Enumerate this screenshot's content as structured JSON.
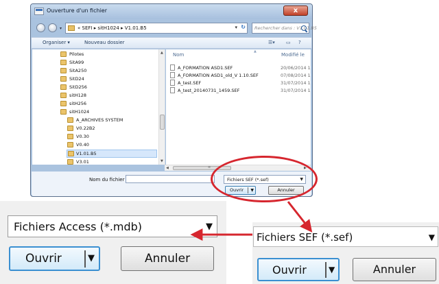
{
  "dialog": {
    "title": "Ouverture d'un fichier",
    "close_label": "x",
    "address": "« SEFI ▸ sitH1024 ▸ V1.01.B5",
    "search_placeholder": "Rechercher dans : V1.01.B5",
    "toolbar": {
      "organize": "Organiser ▾",
      "new_folder": "Nouveau dossier"
    },
    "tree_items": [
      {
        "label": "Pilotes"
      },
      {
        "label": "SitA99"
      },
      {
        "label": "SitA250"
      },
      {
        "label": "SitD24"
      },
      {
        "label": "SitD256"
      },
      {
        "label": "sitH128"
      },
      {
        "label": "sitH256"
      },
      {
        "label": "sitH1024"
      },
      {
        "label": "A_ARCHIVES SYSTEM"
      },
      {
        "label": "V0.22B2"
      },
      {
        "label": "V0.30"
      },
      {
        "label": "V0.40"
      },
      {
        "label": "V1.01.B5"
      },
      {
        "label": "V3.01"
      }
    ],
    "columns": {
      "name": "Nom",
      "modified": "Modifié le"
    },
    "files": [
      {
        "name": "A_FORMATION ASD1.SEF",
        "date": "20/06/2014 1"
      },
      {
        "name": "A_FORMATION ASD1_old_V 1.10.SEF",
        "date": "07/08/2014 1"
      },
      {
        "name": "A_test.SEF",
        "date": "31/07/2014 1"
      },
      {
        "name": "A_test_20140731_1459.SEF",
        "date": "31/07/2014 1"
      }
    ],
    "filename_label": "Nom du fichier :",
    "filename_value": "",
    "filter_value": "Fichiers SEF (*.sef)",
    "open_label": "Ouvrir",
    "cancel_label": "Annuler"
  },
  "zoom_left": {
    "filter_value": "Fichiers Access (*.mdb)",
    "open_label": "Ouvrir",
    "cancel_label": "Annuler"
  },
  "zoom_right": {
    "filter_value": "Fichiers SEF (*.sef)",
    "open_label": "Ouvrir",
    "cancel_label": "Annuler"
  },
  "colors": {
    "highlight_red": "#d6262e",
    "accent_blue": "#3a8fd1",
    "folder_yellow": "#ebc46b"
  }
}
